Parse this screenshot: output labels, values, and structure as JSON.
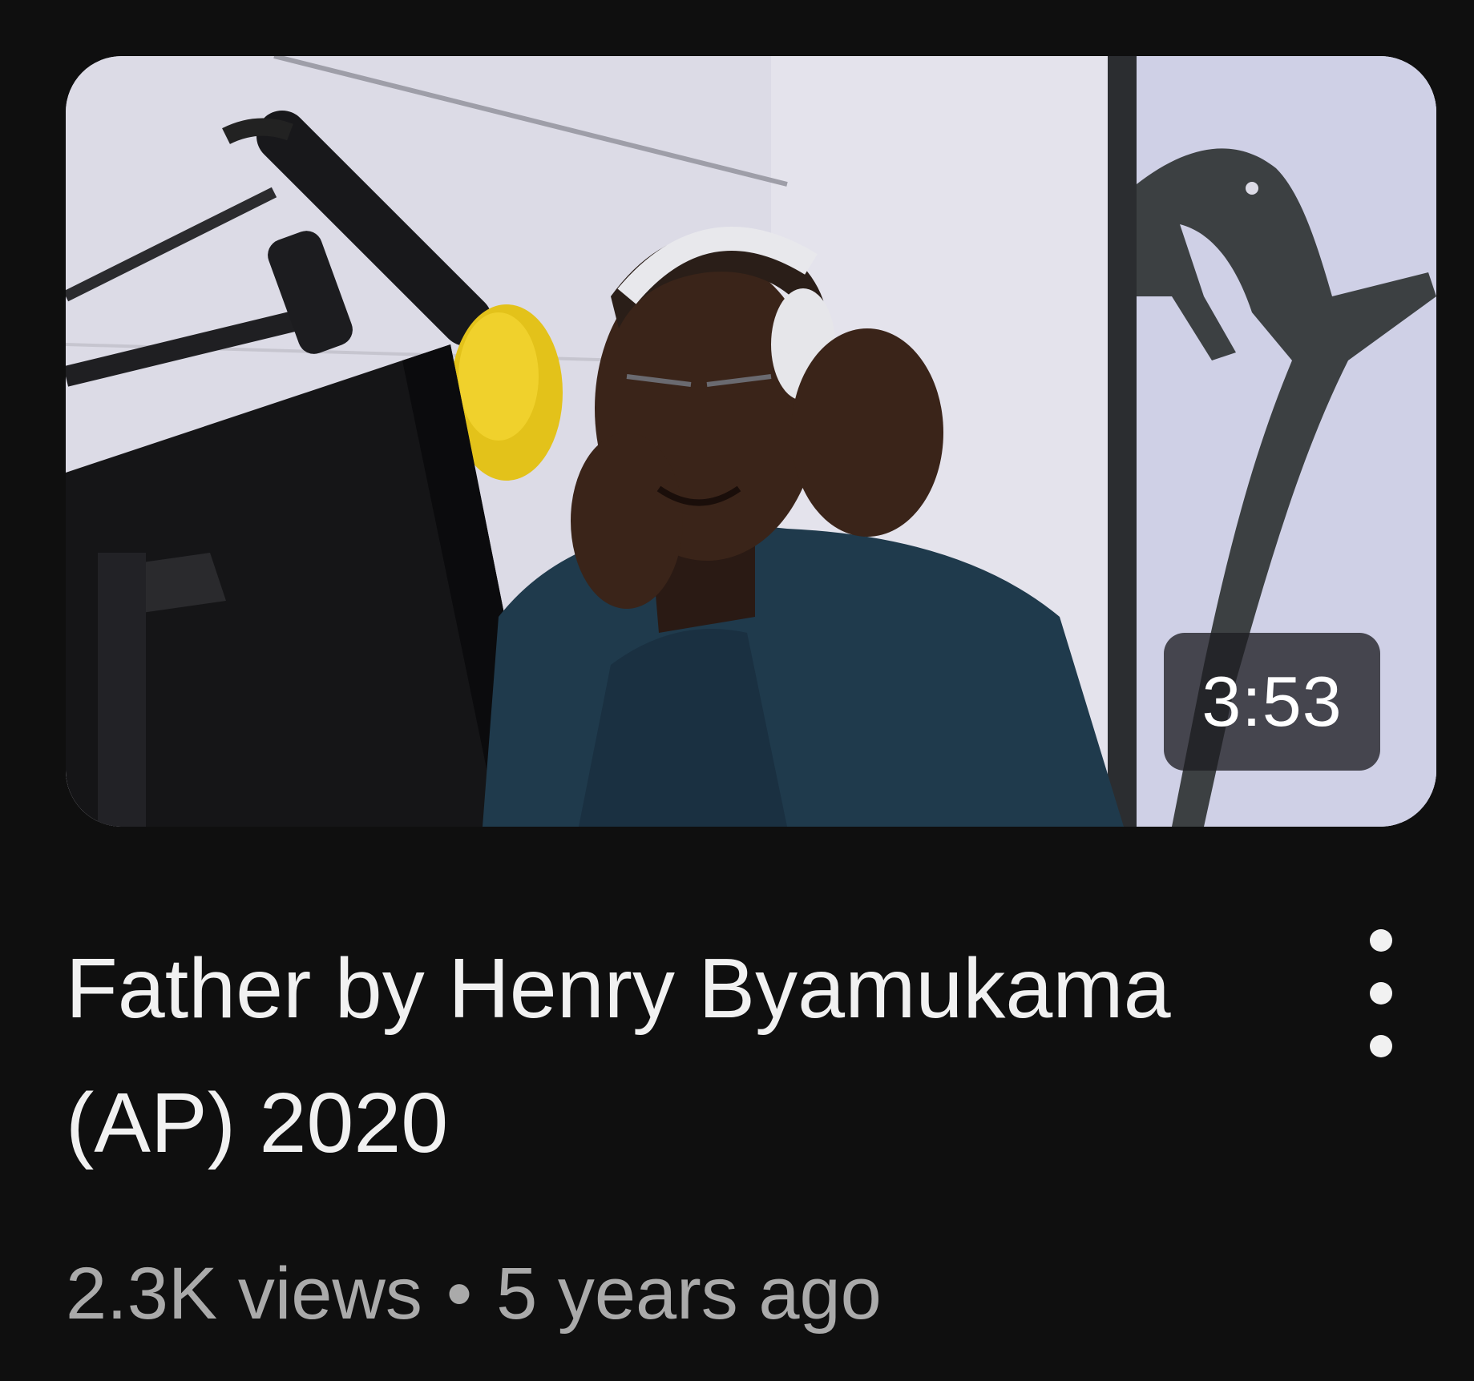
{
  "video": {
    "duration": "3:53",
    "title": "Father by Henry Byamukama (AP) 2020",
    "views": "2.3K views",
    "separator": "•",
    "age": "5 years ago"
  },
  "icons": {
    "menu": "more-vert-icon"
  },
  "colors": {
    "background": "#0f0f0f",
    "title_text": "#f1f1f1",
    "meta_text": "#aaaaaa",
    "duration_badge": "#1e1e22"
  }
}
